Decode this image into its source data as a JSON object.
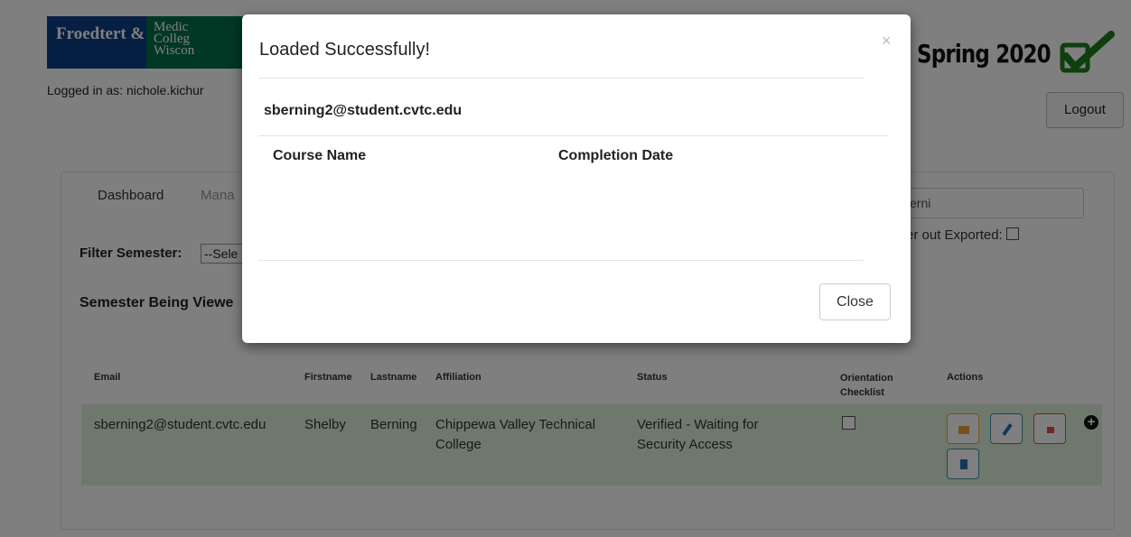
{
  "header": {
    "logo_left": "Froedtert &",
    "logo_right_l1": "Medic",
    "logo_right_l2": "Colleg",
    "logo_right_l3": "Wiscon",
    "logged_in": "Logged in as: nichole.kichur",
    "semester": "Spring 2020",
    "logout_label": "Logout"
  },
  "nav": {
    "dashboard": "Dashboard",
    "manage": "Mana"
  },
  "search": {
    "value": "erni"
  },
  "filter": {
    "exported_label": "er out Exported:",
    "semester_label": "Filter Semester:",
    "semester_select": "--Sele",
    "viewed_label": "Semester Being Viewe"
  },
  "table": {
    "headers": {
      "email": "Email",
      "firstname": "Firstname",
      "lastname": "Lastname",
      "affiliation": "Affiliation",
      "status": "Status",
      "orientation_l1": "Orientation",
      "orientation_l2": "Checklist",
      "actions": "Actions"
    },
    "row": {
      "email": "sberning2@student.cvtc.edu",
      "firstname": "Shelby",
      "lastname": "Berning",
      "affiliation_l1": "Chippewa Valley Technical",
      "affiliation_l2": "College",
      "status_l1": "Verified - Waiting for",
      "status_l2": "Security Access"
    }
  },
  "modal": {
    "title": "Loaded Successfully!",
    "close_x": "×",
    "email": "sberning2@student.cvtc.edu",
    "col_course": "Course Name",
    "col_date": "Completion Date",
    "close_label": "Close"
  },
  "icons": {
    "expand": "+"
  },
  "colors": {
    "row_highlight": "#dff0d8",
    "logo_blue": "#0e3f86",
    "logo_green": "#00704a",
    "check_green": "#1e7d1e"
  }
}
